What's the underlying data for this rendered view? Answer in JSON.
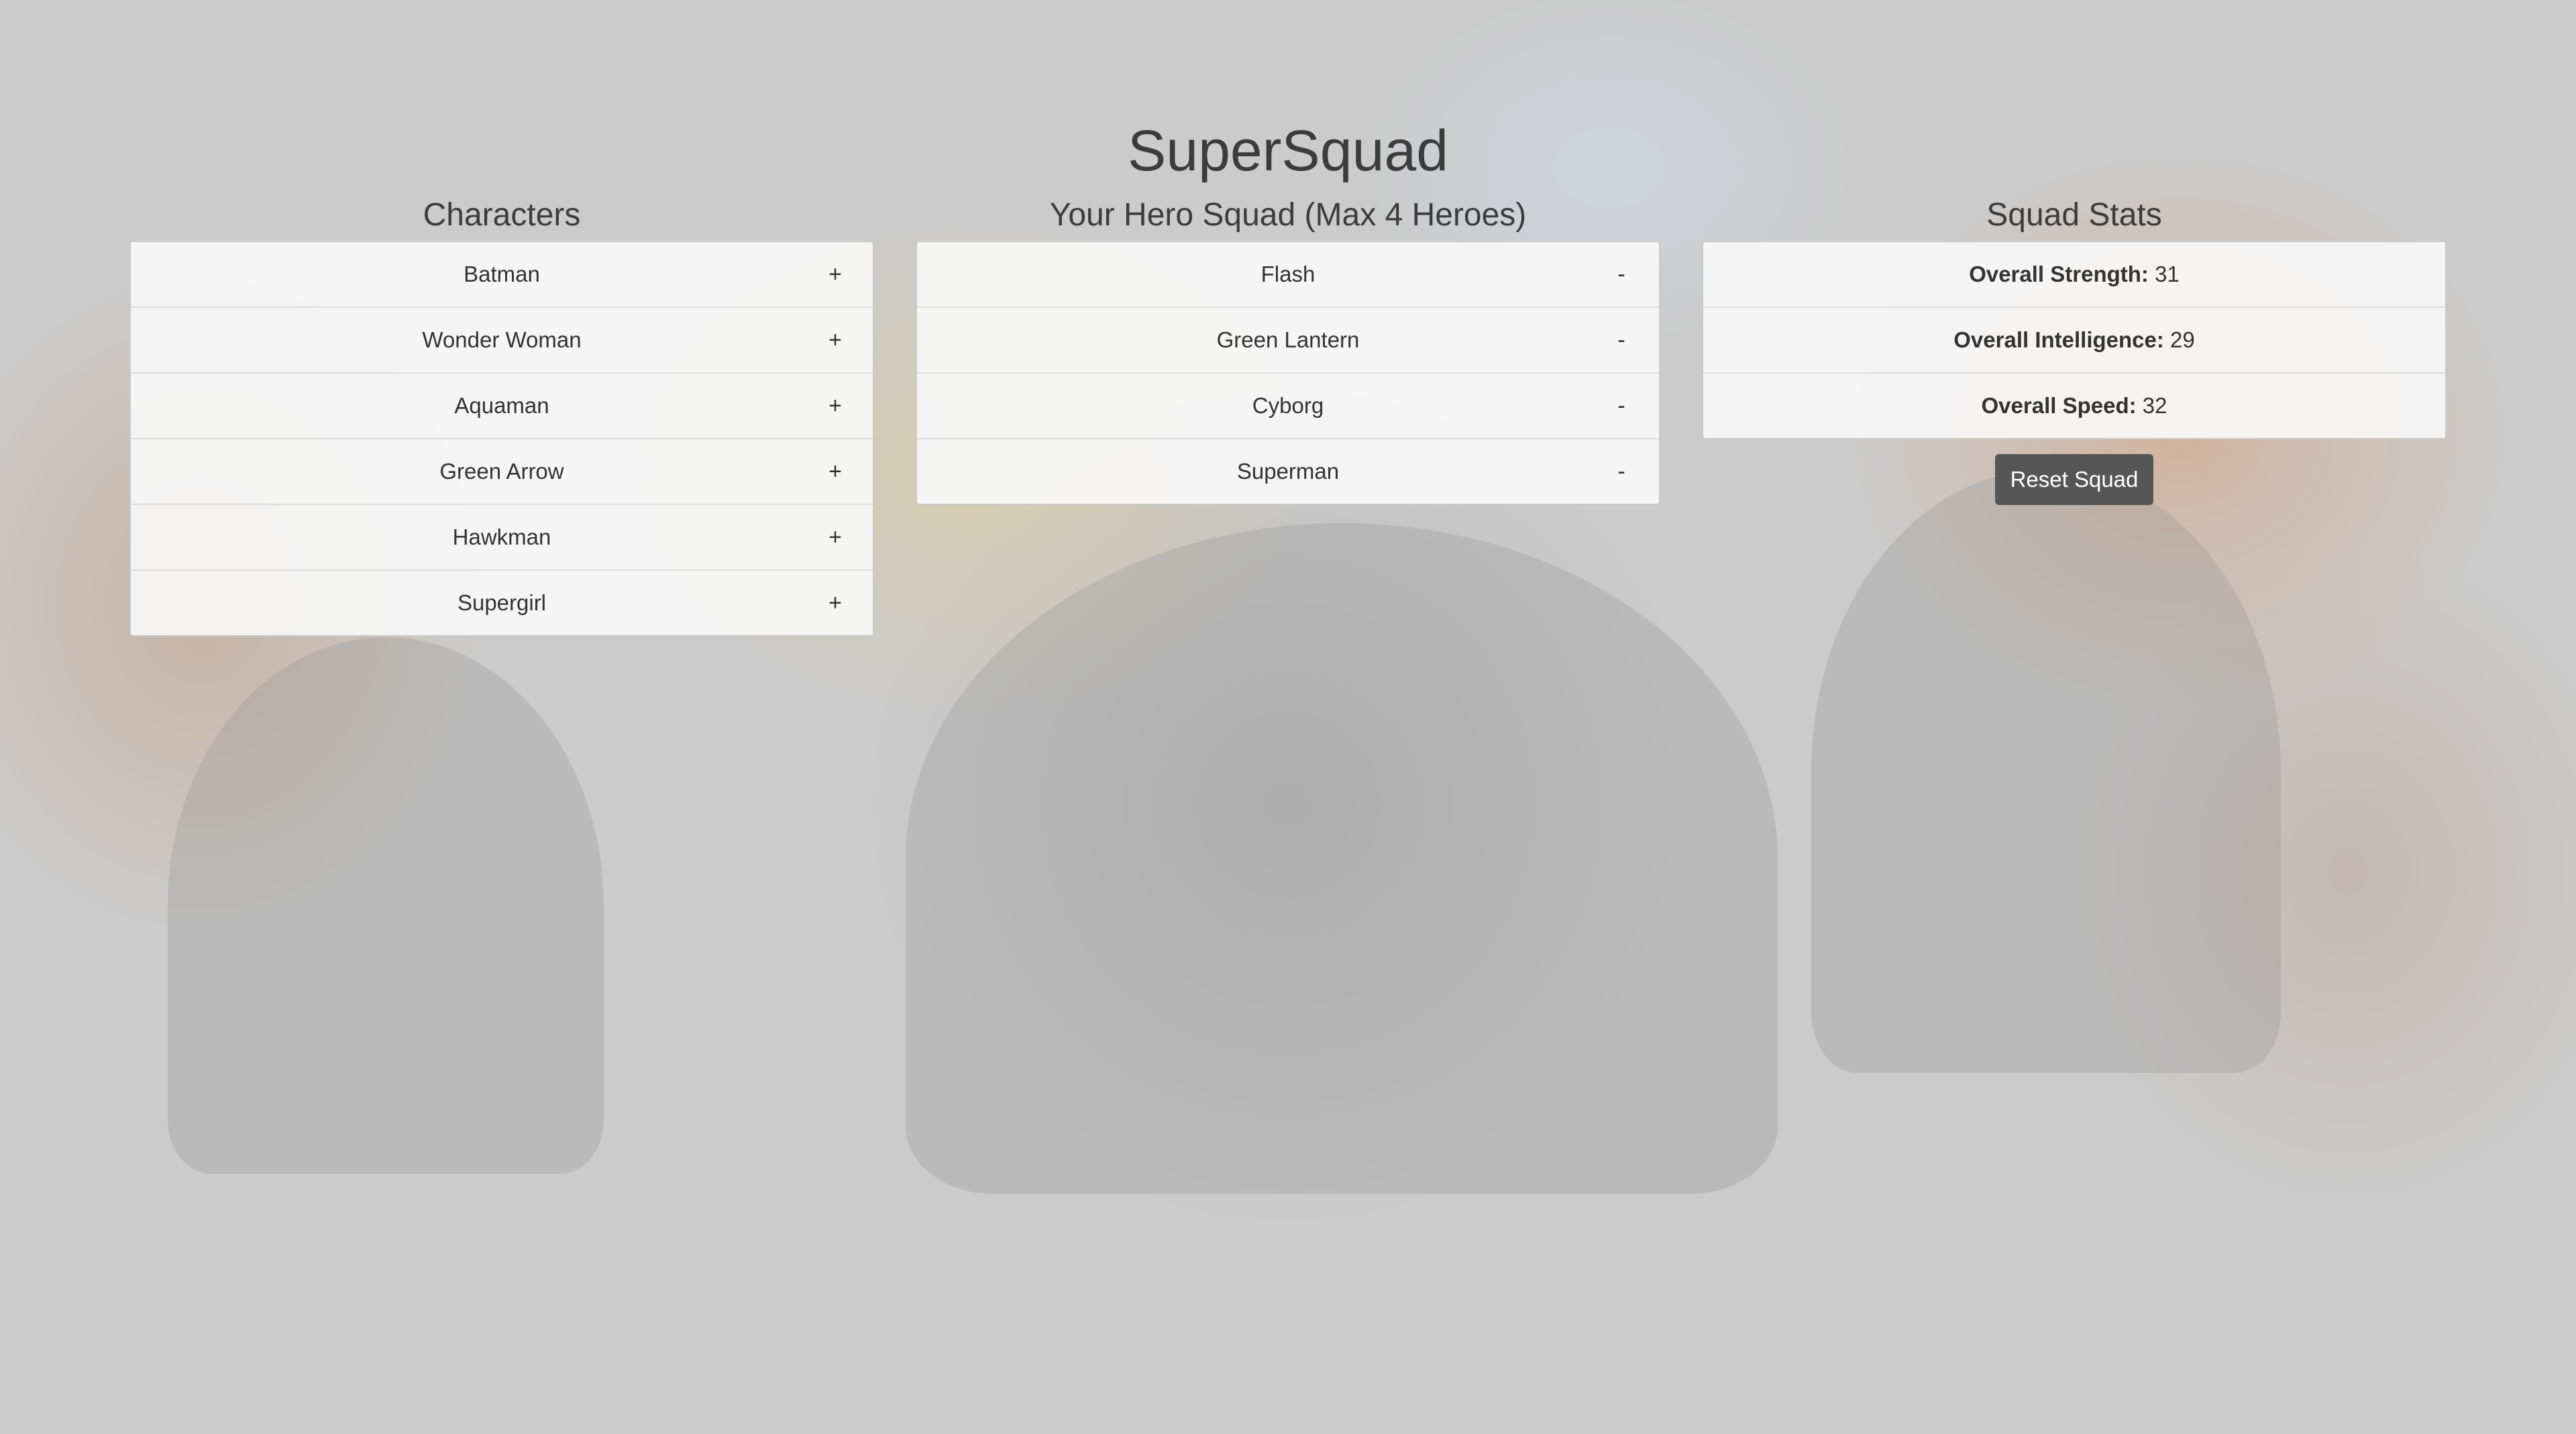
{
  "app": {
    "title": "SuperSquad"
  },
  "characters": {
    "heading": "Characters",
    "add_symbol": "+",
    "items": [
      {
        "name": "Batman"
      },
      {
        "name": "Wonder Woman"
      },
      {
        "name": "Aquaman"
      },
      {
        "name": "Green Arrow"
      },
      {
        "name": "Hawkman"
      },
      {
        "name": "Supergirl"
      }
    ]
  },
  "squad": {
    "heading": "Your Hero Squad (Max 4 Heroes)",
    "remove_symbol": "-",
    "items": [
      {
        "name": "Flash"
      },
      {
        "name": "Green Lantern"
      },
      {
        "name": "Cyborg"
      },
      {
        "name": "Superman"
      }
    ]
  },
  "stats": {
    "heading": "Squad Stats",
    "items": [
      {
        "label": "Overall Strength:",
        "value": "31"
      },
      {
        "label": "Overall Intelligence:",
        "value": "29"
      },
      {
        "label": "Overall Speed:",
        "value": "32"
      }
    ],
    "reset_label": "Reset Squad"
  },
  "colors": {
    "page_background": "#cbcbcb",
    "panel_background": "#f8f8f8",
    "button_background": "#565656",
    "button_text": "#ffffff",
    "text": "#333333"
  }
}
